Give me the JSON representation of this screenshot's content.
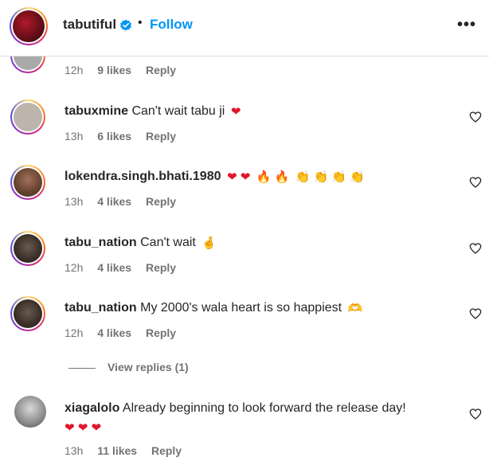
{
  "header": {
    "username": "tabutiful",
    "separator": "•",
    "follow_label": "Follow",
    "more_label": "•••"
  },
  "comments": [
    {
      "user": "",
      "text": "",
      "time": "12h",
      "likes": "9 likes",
      "reply": "Reply",
      "emoji": ""
    },
    {
      "user": "tabuxmine",
      "text": "Can't wait tabu ji",
      "time": "13h",
      "likes": "6 likes",
      "reply": "Reply",
      "emoji": "❤"
    },
    {
      "user": "lokendra.singh.bhati.1980",
      "text": "",
      "time": "13h",
      "likes": "4 likes",
      "reply": "Reply",
      "emoji": ""
    },
    {
      "user": "tabu_nation",
      "text": "Can't wait",
      "time": "12h",
      "likes": "4 likes",
      "reply": "Reply",
      "emoji": "🤞"
    },
    {
      "user": "tabu_nation",
      "text": "My 2000's wala heart is so happiest",
      "time": "12h",
      "likes": "4 likes",
      "reply": "Reply",
      "emoji": "🫶"
    },
    {
      "user": "xiagalolo",
      "text": "Already beginning to look forward the release day!",
      "time": "13h",
      "likes": "11 likes",
      "reply": "Reply",
      "emoji": ""
    }
  ],
  "lokendra_emojis": {
    "hearts": "❤ ❤",
    "fire": "🔥 🔥",
    "clap": "👏 👏 👏 👏"
  },
  "xiagalolo_hearts": "❤ ❤ ❤",
  "view_replies": "View replies (1)",
  "colors": {
    "accent": "#0095f6",
    "muted": "#737373",
    "text": "#262626",
    "heart": "#e0162b"
  }
}
